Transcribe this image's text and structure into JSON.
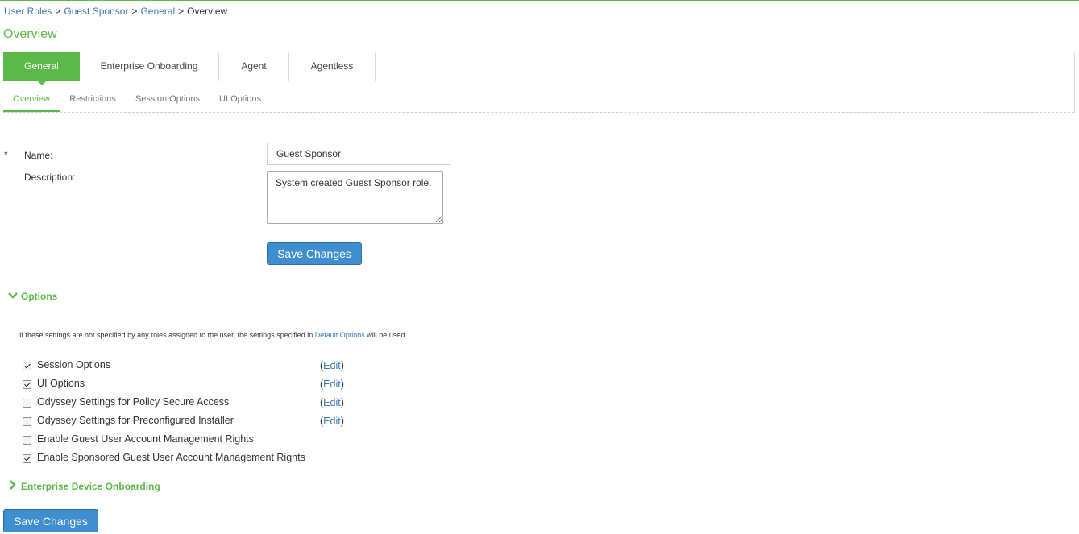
{
  "breadcrumb": {
    "items": [
      "User Roles",
      "Guest Sponsor",
      "General"
    ],
    "current": "Overview",
    "separator": ">"
  },
  "page_title": "Overview",
  "main_tabs": [
    {
      "label": "General",
      "active": true
    },
    {
      "label": "Enterprise Onboarding",
      "active": false
    },
    {
      "label": "Agent",
      "active": false
    },
    {
      "label": "Agentless",
      "active": false
    }
  ],
  "sub_tabs": [
    {
      "label": "Overview",
      "active": true
    },
    {
      "label": "Restrictions",
      "active": false
    },
    {
      "label": "Session Options",
      "active": false
    },
    {
      "label": "UI Options",
      "active": false
    }
  ],
  "form": {
    "required_marker": "*",
    "name_label": "Name:",
    "name_value": "Guest Sponsor",
    "description_label": "Description:",
    "description_value": "System created Guest Sponsor role.",
    "save_label": "Save Changes"
  },
  "options_section": {
    "title": "Options",
    "expanded": true,
    "info_prefix": "If these settings are not specified by any roles assigned to the user, the settings specified in",
    "info_link": "Default Options",
    "info_suffix": "will be used.",
    "items": [
      {
        "label": "Session Options",
        "checked": true,
        "edit": "Edit"
      },
      {
        "label": "UI Options",
        "checked": true,
        "edit": "Edit"
      },
      {
        "label": "Odyssey Settings for Policy Secure Access",
        "checked": false,
        "edit": "Edit"
      },
      {
        "label": "Odyssey Settings for Preconfigured Installer",
        "checked": false,
        "edit": "Edit"
      },
      {
        "label": "Enable Guest User Account Management Rights",
        "checked": false,
        "edit": null
      },
      {
        "label": "Enable Sponsored Guest User Account Management Rights",
        "checked": true,
        "edit": null
      }
    ]
  },
  "onboarding_section": {
    "title": "Enterprise Device Onboarding",
    "expanded": false
  },
  "footer": {
    "save_label": "Save Changes"
  },
  "colors": {
    "accent_green": "#5cb848",
    "link_blue": "#3a79b8",
    "button_blue": "#3f8ecf"
  }
}
